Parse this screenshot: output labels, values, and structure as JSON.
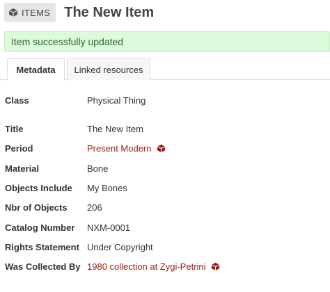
{
  "header": {
    "badge_label": "ITEMS",
    "badge_icon": "cube-icon",
    "title": "The New Item"
  },
  "flash": {
    "message": "Item successfully updated",
    "bg_color": "#dcfadc",
    "text_color": "#2d6a2d"
  },
  "tabs": [
    {
      "label": "Metadata",
      "active": true
    },
    {
      "label": "Linked resources",
      "active": false
    }
  ],
  "link_color": "#9a1d10",
  "metadata": [
    {
      "label": "Class",
      "value": "Physical Thing",
      "link": false
    },
    {
      "label": "Title",
      "value": "The New Item",
      "link": false
    },
    {
      "label": "Period",
      "value": "Present Modern",
      "link": true,
      "icon": "cube-icon"
    },
    {
      "label": "Material",
      "value": "Bone",
      "link": false
    },
    {
      "label": "Objects Include",
      "value": "My Bones",
      "link": false
    },
    {
      "label": "Nbr of Objects",
      "value": "206",
      "link": false
    },
    {
      "label": "Catalog Number",
      "value": "NXM-0001",
      "link": false
    },
    {
      "label": "Rights Statement",
      "value": "Under Copyright",
      "link": false
    },
    {
      "label": "Was Collected By",
      "value": "1980 collection at Zygi-Petrini",
      "link": true,
      "icon": "cube-icon"
    }
  ]
}
